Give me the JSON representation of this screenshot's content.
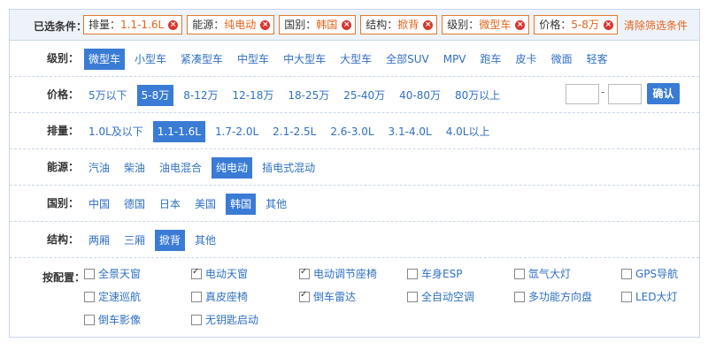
{
  "selected": {
    "label": "已选条件：",
    "chips": [
      {
        "key": "排量：",
        "value": "1.1-1.6L"
      },
      {
        "key": "能源：",
        "value": "纯电动"
      },
      {
        "key": "国别：",
        "value": "韩国"
      },
      {
        "key": "结构：",
        "value": "掀背"
      },
      {
        "key": "级别：",
        "value": "微型车"
      },
      {
        "key": "价格：",
        "value": "5-8万"
      }
    ],
    "clear_label": "清除筛选条件"
  },
  "filters": {
    "level": {
      "label": "级别：",
      "options": [
        "微型车",
        "小型车",
        "紧凑型车",
        "中型车",
        "中大型车",
        "大型车",
        "全部SUV",
        "MPV",
        "跑车",
        "皮卡",
        "微面",
        "轻客"
      ],
      "active": 0
    },
    "price": {
      "label": "价格：",
      "options": [
        "5万以下",
        "5-8万",
        "8-12万",
        "12-18万",
        "18-25万",
        "25-40万",
        "40-80万",
        "80万以上"
      ],
      "active": 1,
      "range_separator": "-",
      "confirm_label": "确认"
    },
    "displacement": {
      "label": "排量：",
      "options": [
        "1.0L及以下",
        "1.1-1.6L",
        "1.7-2.0L",
        "2.1-2.5L",
        "2.6-3.0L",
        "3.1-4.0L",
        "4.0L以上"
      ],
      "active": 1
    },
    "energy": {
      "label": "能源：",
      "options": [
        "汽油",
        "柴油",
        "油电混合",
        "纯电动",
        "插电式混动"
      ],
      "active": 3
    },
    "country": {
      "label": "国别：",
      "options": [
        "中国",
        "德国",
        "日本",
        "美国",
        "韩国",
        "其他"
      ],
      "active": 4
    },
    "structure": {
      "label": "结构：",
      "options": [
        "两厢",
        "三厢",
        "掀背",
        "其他"
      ],
      "active": 2
    }
  },
  "config": {
    "label": "按配置：",
    "items": [
      {
        "label": "全景天窗",
        "checked": false
      },
      {
        "label": "电动天窗",
        "checked": true
      },
      {
        "label": "电动调节座椅",
        "checked": true
      },
      {
        "label": "车身ESP",
        "checked": false
      },
      {
        "label": "氙气大灯",
        "checked": false
      },
      {
        "label": "GPS导航",
        "checked": false
      },
      {
        "label": "定速巡航",
        "checked": false
      },
      {
        "label": "真皮座椅",
        "checked": false
      },
      {
        "label": "倒车雷达",
        "checked": true
      },
      {
        "label": "全自动空调",
        "checked": false
      },
      {
        "label": "多功能方向盘",
        "checked": false
      },
      {
        "label": "LED大灯",
        "checked": false
      },
      {
        "label": "倒车影像",
        "checked": false
      },
      {
        "label": "无钥匙启动",
        "checked": false
      }
    ]
  }
}
